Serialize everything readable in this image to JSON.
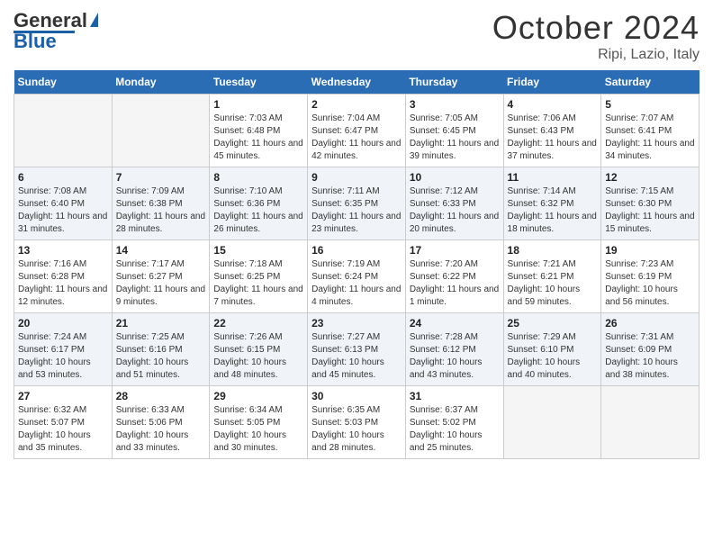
{
  "logo": {
    "line1": "General",
    "line2": "Blue"
  },
  "header": {
    "month_year": "October 2024",
    "location": "Ripi, Lazio, Italy"
  },
  "weekdays": [
    "Sunday",
    "Monday",
    "Tuesday",
    "Wednesday",
    "Thursday",
    "Friday",
    "Saturday"
  ],
  "weeks": [
    [
      {
        "num": "",
        "empty": true
      },
      {
        "num": "",
        "empty": true
      },
      {
        "num": "1",
        "sunrise": "7:03 AM",
        "sunset": "6:48 PM",
        "daylight": "11 hours and 45 minutes."
      },
      {
        "num": "2",
        "sunrise": "7:04 AM",
        "sunset": "6:47 PM",
        "daylight": "11 hours and 42 minutes."
      },
      {
        "num": "3",
        "sunrise": "7:05 AM",
        "sunset": "6:45 PM",
        "daylight": "11 hours and 39 minutes."
      },
      {
        "num": "4",
        "sunrise": "7:06 AM",
        "sunset": "6:43 PM",
        "daylight": "11 hours and 37 minutes."
      },
      {
        "num": "5",
        "sunrise": "7:07 AM",
        "sunset": "6:41 PM",
        "daylight": "11 hours and 34 minutes."
      }
    ],
    [
      {
        "num": "6",
        "sunrise": "7:08 AM",
        "sunset": "6:40 PM",
        "daylight": "11 hours and 31 minutes."
      },
      {
        "num": "7",
        "sunrise": "7:09 AM",
        "sunset": "6:38 PM",
        "daylight": "11 hours and 28 minutes."
      },
      {
        "num": "8",
        "sunrise": "7:10 AM",
        "sunset": "6:36 PM",
        "daylight": "11 hours and 26 minutes."
      },
      {
        "num": "9",
        "sunrise": "7:11 AM",
        "sunset": "6:35 PM",
        "daylight": "11 hours and 23 minutes."
      },
      {
        "num": "10",
        "sunrise": "7:12 AM",
        "sunset": "6:33 PM",
        "daylight": "11 hours and 20 minutes."
      },
      {
        "num": "11",
        "sunrise": "7:14 AM",
        "sunset": "6:32 PM",
        "daylight": "11 hours and 18 minutes."
      },
      {
        "num": "12",
        "sunrise": "7:15 AM",
        "sunset": "6:30 PM",
        "daylight": "11 hours and 15 minutes."
      }
    ],
    [
      {
        "num": "13",
        "sunrise": "7:16 AM",
        "sunset": "6:28 PM",
        "daylight": "11 hours and 12 minutes."
      },
      {
        "num": "14",
        "sunrise": "7:17 AM",
        "sunset": "6:27 PM",
        "daylight": "11 hours and 9 minutes."
      },
      {
        "num": "15",
        "sunrise": "7:18 AM",
        "sunset": "6:25 PM",
        "daylight": "11 hours and 7 minutes."
      },
      {
        "num": "16",
        "sunrise": "7:19 AM",
        "sunset": "6:24 PM",
        "daylight": "11 hours and 4 minutes."
      },
      {
        "num": "17",
        "sunrise": "7:20 AM",
        "sunset": "6:22 PM",
        "daylight": "11 hours and 1 minute."
      },
      {
        "num": "18",
        "sunrise": "7:21 AM",
        "sunset": "6:21 PM",
        "daylight": "10 hours and 59 minutes."
      },
      {
        "num": "19",
        "sunrise": "7:23 AM",
        "sunset": "6:19 PM",
        "daylight": "10 hours and 56 minutes."
      }
    ],
    [
      {
        "num": "20",
        "sunrise": "7:24 AM",
        "sunset": "6:17 PM",
        "daylight": "10 hours and 53 minutes."
      },
      {
        "num": "21",
        "sunrise": "7:25 AM",
        "sunset": "6:16 PM",
        "daylight": "10 hours and 51 minutes."
      },
      {
        "num": "22",
        "sunrise": "7:26 AM",
        "sunset": "6:15 PM",
        "daylight": "10 hours and 48 minutes."
      },
      {
        "num": "23",
        "sunrise": "7:27 AM",
        "sunset": "6:13 PM",
        "daylight": "10 hours and 45 minutes."
      },
      {
        "num": "24",
        "sunrise": "7:28 AM",
        "sunset": "6:12 PM",
        "daylight": "10 hours and 43 minutes."
      },
      {
        "num": "25",
        "sunrise": "7:29 AM",
        "sunset": "6:10 PM",
        "daylight": "10 hours and 40 minutes."
      },
      {
        "num": "26",
        "sunrise": "7:31 AM",
        "sunset": "6:09 PM",
        "daylight": "10 hours and 38 minutes."
      }
    ],
    [
      {
        "num": "27",
        "sunrise": "6:32 AM",
        "sunset": "5:07 PM",
        "daylight": "10 hours and 35 minutes."
      },
      {
        "num": "28",
        "sunrise": "6:33 AM",
        "sunset": "5:06 PM",
        "daylight": "10 hours and 33 minutes."
      },
      {
        "num": "29",
        "sunrise": "6:34 AM",
        "sunset": "5:05 PM",
        "daylight": "10 hours and 30 minutes."
      },
      {
        "num": "30",
        "sunrise": "6:35 AM",
        "sunset": "5:03 PM",
        "daylight": "10 hours and 28 minutes."
      },
      {
        "num": "31",
        "sunrise": "6:37 AM",
        "sunset": "5:02 PM",
        "daylight": "10 hours and 25 minutes."
      },
      {
        "num": "",
        "empty": true
      },
      {
        "num": "",
        "empty": true
      }
    ]
  ]
}
